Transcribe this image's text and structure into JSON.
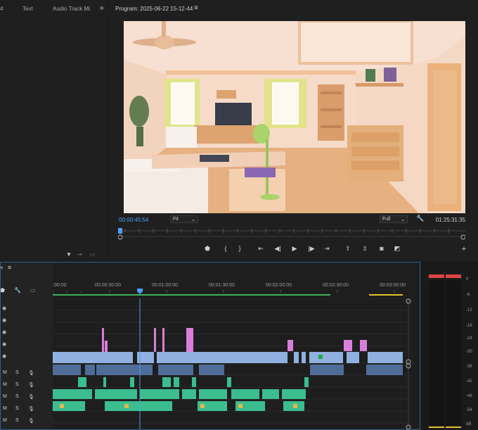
{
  "left_panel": {
    "tabs": [
      "4",
      "Text",
      "Audio Track Mi"
    ],
    "overflow_label": "»"
  },
  "program": {
    "title": "Program: 2025-06-22 15-12-44",
    "menu": "≡",
    "timecode_current": "00:00:45:54",
    "timecode_duration": "01:25:31:35",
    "zoom": "Fit",
    "resolution": "Full"
  },
  "timeline": {
    "menu": "≡",
    "ruler_labels": [
      ":00:00",
      "00:00:30:00",
      "00:01:00:00",
      "00:01:30:00",
      "00:02:00:00",
      "00:02:30:00",
      "00:03:00:00"
    ],
    "track_buttons": {
      "m": "M",
      "s": "S"
    }
  },
  "meter": {
    "db_labels": [
      "0",
      "-6",
      "-12",
      "-18",
      "-24",
      "-30",
      "-36",
      "-42",
      "-48",
      "-54",
      "dB"
    ]
  },
  "colors": {
    "accent_blue": "#4a9ff5",
    "video_clip": "#8fb0e0",
    "audio_clip": "#3bbd8f",
    "pink_clip": "#d97fd9"
  }
}
